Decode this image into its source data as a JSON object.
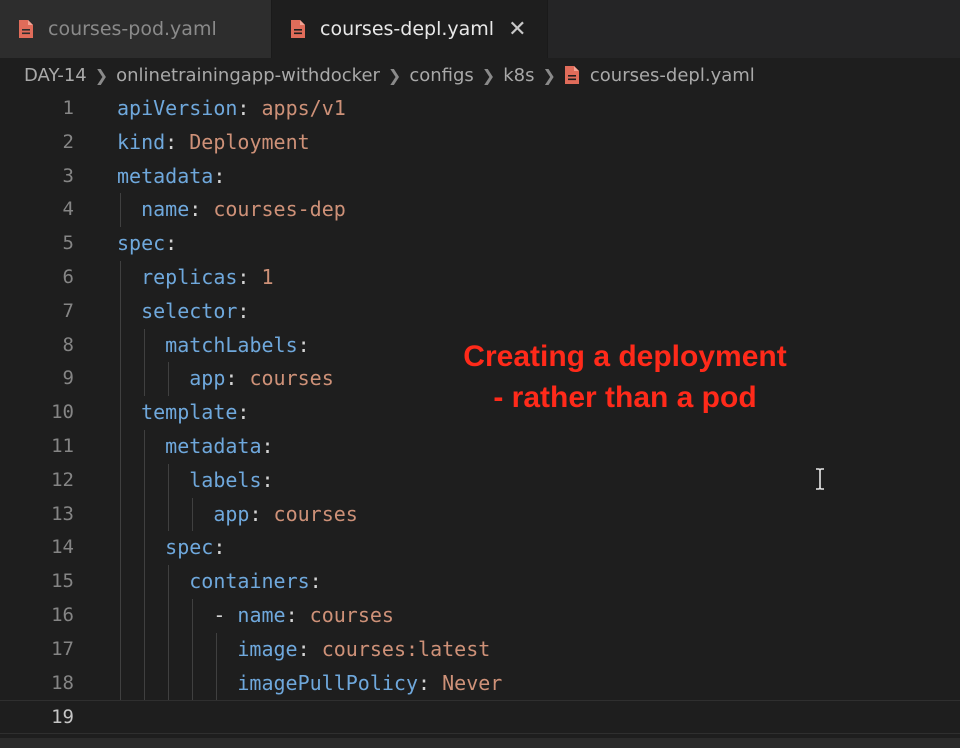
{
  "tabs": [
    {
      "label": "courses-pod.yaml",
      "icon": "yaml-file-icon",
      "active": false
    },
    {
      "label": "courses-depl.yaml",
      "icon": "yaml-file-icon",
      "active": true,
      "close": "✕"
    }
  ],
  "breadcrumb": [
    "DAY-14",
    "onlinetrainingapp-withdocker",
    "configs",
    "k8s",
    "courses-depl.yaml"
  ],
  "annotation": {
    "line1": "Creating a deployment",
    "line2": "- rather than a pod"
  },
  "colors": {
    "key": "#6fa8dc",
    "value": "#ce9178",
    "annotation": "#ff2a1a",
    "file_icon": "#e06c5a"
  },
  "code": [
    {
      "n": "1",
      "indent": 0,
      "key": "apiVersion",
      "value": "apps/v1"
    },
    {
      "n": "2",
      "indent": 0,
      "key": "kind",
      "value": "Deployment"
    },
    {
      "n": "3",
      "indent": 0,
      "key": "metadata",
      "value": ""
    },
    {
      "n": "4",
      "indent": 1,
      "key": "name",
      "value": "courses-dep"
    },
    {
      "n": "5",
      "indent": 0,
      "key": "spec",
      "value": ""
    },
    {
      "n": "6",
      "indent": 1,
      "key": "replicas",
      "value": "1"
    },
    {
      "n": "7",
      "indent": 1,
      "key": "selector",
      "value": ""
    },
    {
      "n": "8",
      "indent": 2,
      "key": "matchLabels",
      "value": ""
    },
    {
      "n": "9",
      "indent": 3,
      "key": "app",
      "value": "courses"
    },
    {
      "n": "10",
      "indent": 1,
      "key": "template",
      "value": ""
    },
    {
      "n": "11",
      "indent": 2,
      "key": "metadata",
      "value": ""
    },
    {
      "n": "12",
      "indent": 3,
      "key": "labels",
      "value": ""
    },
    {
      "n": "13",
      "indent": 4,
      "key": "app",
      "value": "courses"
    },
    {
      "n": "14",
      "indent": 2,
      "key": "spec",
      "value": ""
    },
    {
      "n": "15",
      "indent": 3,
      "key": "containers",
      "value": ""
    },
    {
      "n": "16",
      "indent": 4,
      "dash": "- ",
      "key": "name",
      "value": "courses"
    },
    {
      "n": "17",
      "indent": 5,
      "key": "image",
      "value": "courses:latest"
    },
    {
      "n": "18",
      "indent": 5,
      "key": "imagePullPolicy",
      "value": "Never"
    },
    {
      "n": "19",
      "indent": 0,
      "key": "",
      "value": "",
      "current": true
    }
  ]
}
